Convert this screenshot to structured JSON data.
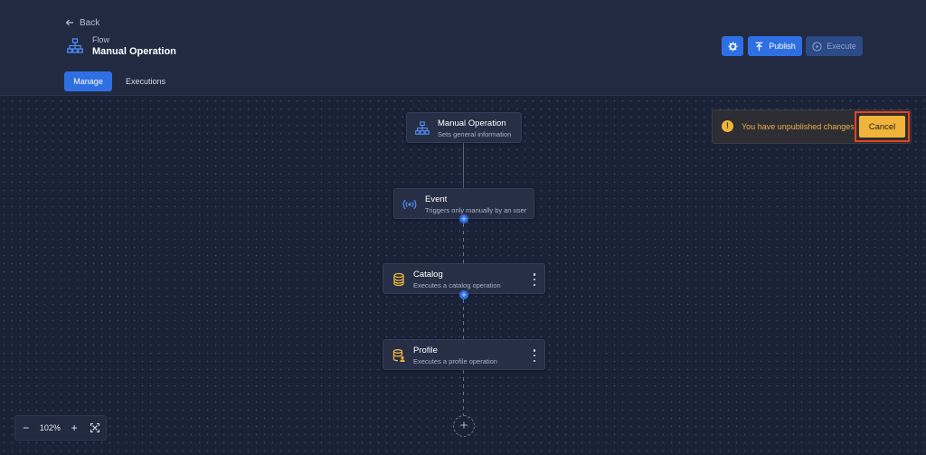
{
  "header": {
    "back_label": "Back",
    "kicker": "Flow",
    "title": "Manual Operation",
    "publish_label": "Publish",
    "execute_label": "Execute"
  },
  "tabs": [
    {
      "label": "Manage",
      "active": true
    },
    {
      "label": "Executions",
      "active": false
    }
  ],
  "nodes": [
    {
      "title": "Manual Operation",
      "subtitle": "Sets general information",
      "icon": "sitemap-icon"
    },
    {
      "title": "Event",
      "subtitle": "Triggers only manually by an user",
      "icon": "broadcast-icon"
    },
    {
      "title": "Catalog",
      "subtitle": "Executes a catalog operation",
      "icon": "database-icon"
    },
    {
      "title": "Profile",
      "subtitle": "Executes a profile operation",
      "icon": "database-user-icon"
    }
  ],
  "toast": {
    "message": "You have unpublished changes",
    "cancel_label": "Cancel"
  },
  "zoom": {
    "level": "102%"
  },
  "colors": {
    "accent": "#2f6fe4",
    "warning": "#f0b43a",
    "highlight": "#e5431f"
  }
}
